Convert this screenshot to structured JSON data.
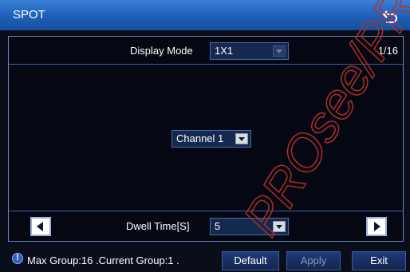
{
  "window": {
    "title": "SPOT"
  },
  "display": {
    "label": "Display Mode",
    "value": "1X1",
    "page_indicator": "1/16"
  },
  "channel": {
    "value": "Channel 1"
  },
  "dwell": {
    "label": "Dwell Time[S]",
    "value": "5"
  },
  "footer": {
    "status": "Max Group:16 .Current Group:1 .",
    "buttons": {
      "default": "Default",
      "apply": "Apply",
      "exit": "Exit"
    }
  },
  "watermark": {
    "text": "PROsee/PRO"
  },
  "icons": {
    "back": "back-arrow-icon",
    "info": "info-icon",
    "prev": "left-triangle-icon",
    "next": "right-triangle-icon",
    "dropdown": "chevron-down-icon"
  },
  "colors": {
    "titlebar": "#1e5fb8",
    "background": "#0a0d1a",
    "border": "#3a5ea8"
  }
}
